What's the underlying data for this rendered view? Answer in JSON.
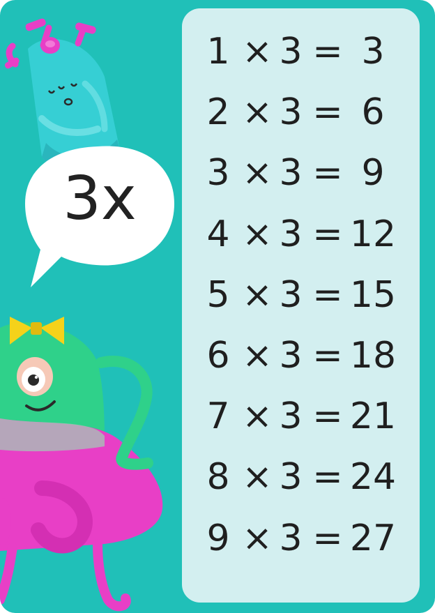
{
  "bubble": {
    "label": "3x"
  },
  "table": {
    "rows": [
      {
        "a": "1",
        "op": "×",
        "b": "3",
        "eq": "=",
        "result": "3"
      },
      {
        "a": "2",
        "op": "×",
        "b": "3",
        "eq": "=",
        "result": "6"
      },
      {
        "a": "3",
        "op": "×",
        "b": "3",
        "eq": "=",
        "result": "9"
      },
      {
        "a": "4",
        "op": "×",
        "b": "3",
        "eq": "=",
        "result": "12"
      },
      {
        "a": "5",
        "op": "×",
        "b": "3",
        "eq": "=",
        "result": "15"
      },
      {
        "a": "6",
        "op": "×",
        "b": "3",
        "eq": "=",
        "result": "18"
      },
      {
        "a": "7",
        "op": "×",
        "b": "3",
        "eq": "=",
        "result": "21"
      },
      {
        "a": "8",
        "op": "×",
        "b": "3",
        "eq": "=",
        "result": "24"
      },
      {
        "a": "9",
        "op": "×",
        "b": "3",
        "eq": "=",
        "result": "27"
      }
    ]
  },
  "colors": {
    "background": "#20c0b8",
    "panel": "#d3eff0",
    "text": "#1f1f1f",
    "bubble": "#ffffff",
    "pink": "#e83fc6",
    "teal_character": "#38d0d6",
    "green_character": "#2fd18a",
    "bow": "#f5d21a"
  }
}
